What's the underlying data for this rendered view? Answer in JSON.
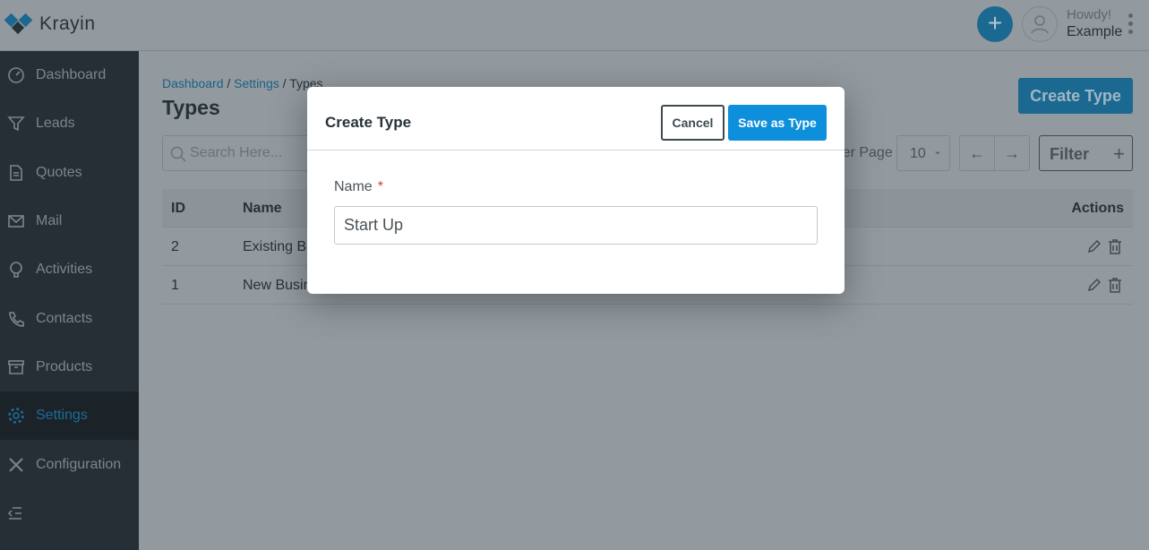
{
  "header": {
    "brand": "Krayin",
    "greeting": "Howdy!",
    "user_name": "Example"
  },
  "sidebar": {
    "items": [
      {
        "label": "Dashboard",
        "icon": "dashboard-icon"
      },
      {
        "label": "Leads",
        "icon": "filter-icon"
      },
      {
        "label": "Quotes",
        "icon": "document-icon"
      },
      {
        "label": "Mail",
        "icon": "mail-icon"
      },
      {
        "label": "Activities",
        "icon": "bulb-icon"
      },
      {
        "label": "Contacts",
        "icon": "phone-icon"
      },
      {
        "label": "Products",
        "icon": "box-icon"
      },
      {
        "label": "Settings",
        "icon": "gear-icon",
        "active": true
      },
      {
        "label": "Configuration",
        "icon": "tools-icon"
      }
    ]
  },
  "breadcrumb": [
    "Dashboard",
    "Settings",
    "Types"
  ],
  "page": {
    "title": "Types",
    "create_button": "Create Type",
    "search_placeholder": "Search Here...",
    "per_page_label": "Per Page",
    "per_page_value": "10",
    "filter_label": "Filter"
  },
  "table": {
    "columns": [
      "ID",
      "Name",
      "Actions"
    ],
    "rows": [
      {
        "id": "2",
        "name": "Existing Business"
      },
      {
        "id": "1",
        "name": "New Business"
      }
    ]
  },
  "modal": {
    "title": "Create Type",
    "cancel": "Cancel",
    "save": "Save as Type",
    "name_label": "Name",
    "required_mark": "*",
    "name_value": "Start Up"
  },
  "colors": {
    "accent": "#0e8fdb",
    "required": "#e53935"
  }
}
